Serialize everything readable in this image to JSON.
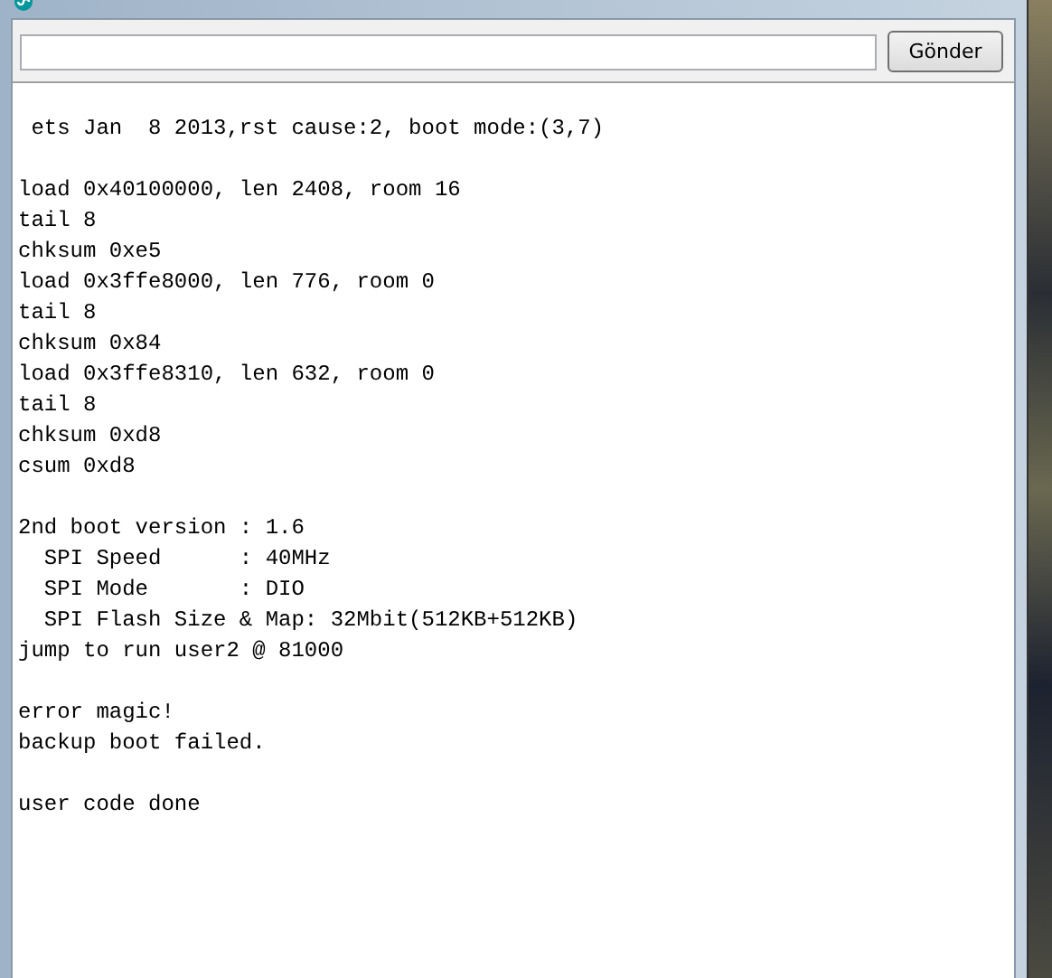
{
  "send_button": {
    "label": "Gönder"
  },
  "output_blocks": [
    [
      " ets Jan  8 2013,rst cause:2, boot mode:(3,7)"
    ],
    [
      "load 0x40100000, len 2408, room 16",
      "tail 8",
      "chksum 0xe5",
      "load 0x3ffe8000, len 776, room 0",
      "tail 8",
      "chksum 0x84",
      "load 0x3ffe8310, len 632, room 0",
      "tail 8",
      "chksum 0xd8",
      "csum 0xd8"
    ],
    [
      "2nd boot version : 1.6",
      "  SPI Speed      : 40MHz",
      "  SPI Mode       : DIO",
      "  SPI Flash Size & Map: 32Mbit(512KB+512KB)",
      "jump to run user2 @ 81000"
    ],
    [
      "error magic!",
      "backup boot failed."
    ],
    [
      "user code done"
    ]
  ]
}
